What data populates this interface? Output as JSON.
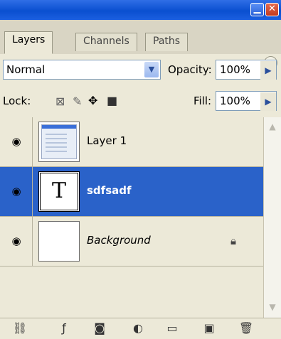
{
  "window": {
    "minimize_glyph": "▁",
    "close_glyph": "✕"
  },
  "tabs": [
    {
      "label": "Layers",
      "active": true
    },
    {
      "label": "Channels",
      "active": false
    },
    {
      "label": "Paths",
      "active": false
    }
  ],
  "blend": {
    "mode": "Normal",
    "opacity_label": "Opacity:",
    "opacity_value": "100%"
  },
  "lock": {
    "label": "Lock:",
    "icons": [
      "lock-transparent-icon",
      "lock-image-icon",
      "lock-position-icon",
      "lock-all-icon"
    ],
    "fill_label": "Fill:",
    "fill_value": "100%"
  },
  "layers": [
    {
      "name": "Layer 1",
      "visible": true,
      "selected": false,
      "thumbnail": "screenshot-thumbnail"
    },
    {
      "name": "sdfsadf",
      "visible": true,
      "selected": true,
      "thumbnail": "T"
    },
    {
      "name": "Background",
      "visible": true,
      "selected": false,
      "locked": true,
      "thumbnail": "blank"
    }
  ],
  "bottom_icons": [
    "link-layers-icon",
    "layer-style-icon",
    "layer-mask-icon",
    "adjustment-layer-icon",
    "new-group-icon",
    "new-layer-icon",
    "delete-layer-icon"
  ],
  "colors": {
    "selection": "#2a62c9",
    "titlebar": "#0a4fd0",
    "panel_bg": "#ece9d8"
  }
}
